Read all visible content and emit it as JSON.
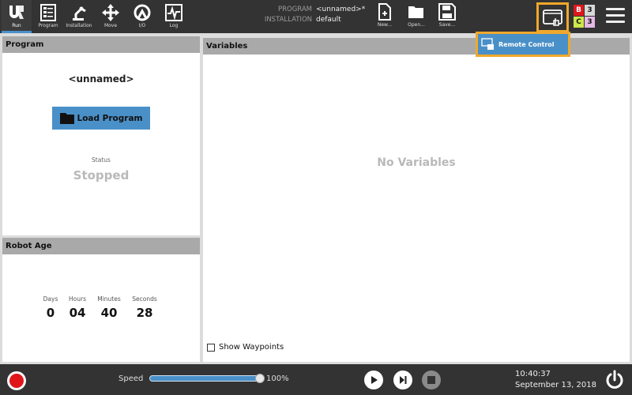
{
  "nav": {
    "items": [
      {
        "label": "Run",
        "icon": "ur-logo-icon",
        "active": true
      },
      {
        "label": "Program",
        "icon": "program-icon"
      },
      {
        "label": "Installation",
        "icon": "robot-arm-icon"
      },
      {
        "label": "Move",
        "icon": "move-arrows-icon"
      },
      {
        "label": "I/O",
        "icon": "io-icon"
      },
      {
        "label": "Log",
        "icon": "log-waveform-icon"
      }
    ]
  },
  "program_info": {
    "program_key": "PROGRAM",
    "program_value": "<unnamed>*",
    "installation_key": "INSTALLATION",
    "installation_value": "default"
  },
  "file_actions": {
    "new_label": "New...",
    "open_label": "Open...",
    "save_label": "Save..."
  },
  "status_indicators": {
    "b_letter": "B",
    "b_count": "3",
    "c_letter": "C",
    "c_count": "3",
    "colors": {
      "b": "#e0161b",
      "c": "#cde84a",
      "count_bg": "#d8d8d8",
      "c_count_bg": "#e6b8e4"
    }
  },
  "remote_popup": {
    "label": "Remote Control",
    "icon": "remote-control-icon"
  },
  "program_panel": {
    "title": "Program",
    "program_name": "<unnamed>",
    "load_button": "Load Program",
    "status_label": "Status",
    "status_value": "Stopped"
  },
  "robot_age": {
    "title": "Robot Age",
    "units": [
      {
        "unit": "Days",
        "value": "0"
      },
      {
        "unit": "Hours",
        "value": "04"
      },
      {
        "unit": "Minutes",
        "value": "40"
      },
      {
        "unit": "Seconds",
        "value": "28"
      }
    ]
  },
  "variables": {
    "title": "Variables",
    "empty_text": "No Variables",
    "show_waypoints_label": "Show Waypoints",
    "show_waypoints_checked": false
  },
  "footer": {
    "speed_label": "Speed",
    "speed_value": "100%",
    "speed_fraction": 1.0,
    "time": "10:40:37",
    "date": "September 13, 2018"
  },
  "colors": {
    "accent": "#4a90c8",
    "highlight": "#f0a82c",
    "bar_bg": "#333333",
    "power_state": "#e0161b"
  }
}
